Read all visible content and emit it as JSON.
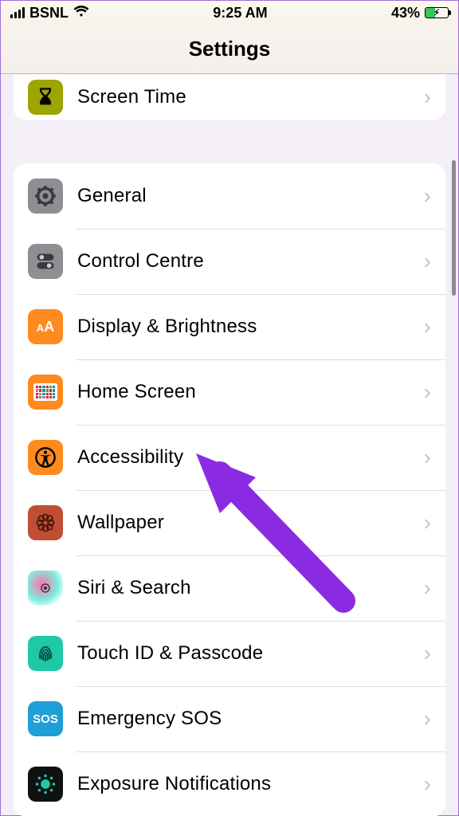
{
  "status": {
    "carrier": "BSNL",
    "time": "9:25 AM",
    "battery_percent": "43%"
  },
  "nav": {
    "title": "Settings"
  },
  "top_group": {
    "screen_time": "Screen Time"
  },
  "group2": {
    "general": "General",
    "control_centre": "Control Centre",
    "display": "Display & Brightness",
    "home_screen": "Home Screen",
    "accessibility": "Accessibility",
    "wallpaper": "Wallpaper",
    "siri": "Siri & Search",
    "touchid": "Touch ID & Passcode",
    "sos": "Emergency SOS",
    "sos_icon_text": "SOS",
    "exposure": "Exposure Notifications"
  }
}
